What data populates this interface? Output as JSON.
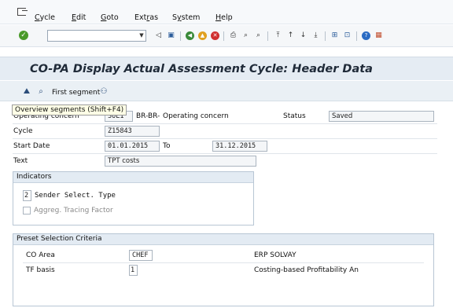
{
  "menu": {
    "items": [
      {
        "pre": "",
        "u": "C",
        "post": "ycle"
      },
      {
        "pre": "",
        "u": "E",
        "post": "dit"
      },
      {
        "pre": "",
        "u": "G",
        "post": "oto"
      },
      {
        "pre": "Ext",
        "u": "r",
        "post": "as"
      },
      {
        "pre": "S",
        "u": "y",
        "post": "stem"
      },
      {
        "pre": "",
        "u": "H",
        "post": "elp"
      }
    ]
  },
  "toolbar": {
    "command_value": ""
  },
  "title": "CO-PA Display Actual Assessment Cycle: Header Data",
  "app_toolbar": {
    "first_segment_label": "First segment"
  },
  "tooltip": "Overview segments  (Shift+F4)",
  "form": {
    "operating_concern_label": "Operating concern",
    "operating_concern_value": "SOL1",
    "operating_concern_desc_prefix": "BR-BR-",
    "operating_concern_desc": "Operating concern",
    "status_label": "Status",
    "status_value": "Saved",
    "cycle_label": "Cycle",
    "cycle_value": "Z15843",
    "start_date_label": "Start Date",
    "start_date_value": "01.01.2015",
    "to_label": "To",
    "end_date_value": "31.12.2015",
    "text_label": "Text",
    "text_value": "TPT costs"
  },
  "indicators": {
    "title": "Indicators",
    "sender_select_value": "2",
    "sender_select_label": "Sender Select. Type",
    "aggreg_label": "Aggreg. Tracing Factor"
  },
  "preset": {
    "title": "Preset Selection Criteria",
    "co_area_label": "CO Area",
    "co_area_value": "CHEF",
    "co_area_desc": "ERP SOLVAY",
    "tf_basis_label": "TF basis",
    "tf_basis_value": "1",
    "tf_basis_desc": "Costing-based Profitability An"
  }
}
